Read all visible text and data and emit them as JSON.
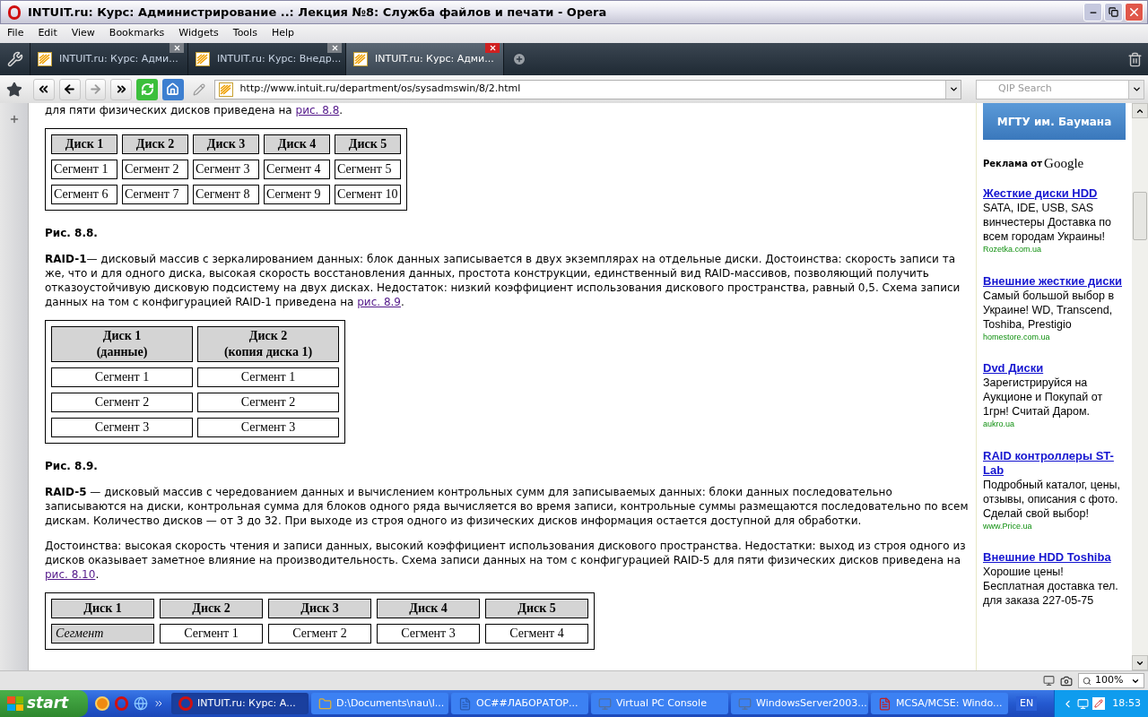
{
  "window": {
    "title": "INTUIT.ru: Курс: Администрирование ..: Лекция №8: Служба файлов и печати - Opera"
  },
  "menu": [
    "File",
    "Edit",
    "View",
    "Bookmarks",
    "Widgets",
    "Tools",
    "Help"
  ],
  "tabs": [
    {
      "label": "INTUIT.ru: Курс: Адми...",
      "selected": false
    },
    {
      "label": "INTUIT.ru: Курс: Внедр...",
      "selected": false
    },
    {
      "label": "INTUIT.ru: Курс: Адми...",
      "selected": true
    }
  ],
  "address_bar": {
    "url": "http://www.intuit.ru/department/os/sysadmswin/8/2.html"
  },
  "search": {
    "placeholder": "QIP Search"
  },
  "article": [
    {
      "kind": "paragraph",
      "text": "для пяти физических дисков приведена на",
      "link": "рис. 8.8",
      "after": "."
    },
    {
      "kind": "table",
      "header": [
        "Диск 1",
        "Диск 2",
        "Диск 3",
        "Диск 4",
        "Диск 5"
      ],
      "rows": [
        {
          "cells": [
            "Сегмент 1",
            "Сегмент 2",
            "Сегмент 3",
            "Сегмент 4",
            "Сегмент 5"
          ],
          "first_shaded": false
        },
        {
          "cells": [
            "Сегмент 6",
            "Сегмент 7",
            "Сегмент 8",
            "Сегмент 9",
            "Сегмент 10"
          ],
          "first_shaded": false
        }
      ]
    },
    {
      "kind": "caption",
      "text": "Рис. 8.8."
    },
    {
      "kind": "paragraph",
      "text": "**RAID-1**— дисковый массив с зеркалированием данных: блок данных записывается в двух экземплярах на отдельные диски. Достоинства: скорость записи та же, что и для одного диска, высокая скорость восстановления данных, простота конструкции, единственный вид RAID-массивов, позволяющий получить отказоустойчивую дисковую подсистему на двух дисках. Недостаток: низкий коэффициент использования дискового пространства, равный 0,5. Схема записи данных на том с конфигурацией RAID-1 приведена на",
      "link": "рис. 8.9",
      "after": "."
    },
    {
      "kind": "table",
      "header": [
        "Диск 1\n(данные)",
        "Диск 2\n(копия диска 1)"
      ],
      "rows": [
        {
          "cells": [
            "Сегмент 1",
            "Сегмент 1"
          ],
          "first_shaded": false
        },
        {
          "cells": [
            "Сегмент 2",
            "Сегмент 2"
          ],
          "first_shaded": false
        },
        {
          "cells": [
            "Сегмент 3",
            "Сегмент 3"
          ],
          "first_shaded": false
        }
      ]
    },
    {
      "kind": "caption",
      "text": "Рис. 8.9."
    },
    {
      "kind": "paragraph",
      "text": "**RAID-5** — дисковый массив с чередованием данных и вычислением контрольных сумм для записываемых данных: блоки данных последовательно записываются на диски, контрольная сумма для блоков одного ряда вычисляется во время записи, контрольные суммы размещаются последовательно по всем дискам. Количество дисков — от 3 до 32. При выходе из строя одного из физических дисков информация остается доступной для обработки."
    },
    {
      "kind": "paragraph",
      "text": "Достоинства: высокая скорость чтения и записи данных, высокий коэффициент использования дискового пространства. Недостатки: выход из строя одного из дисков оказывает заметное влияние на производительность. Схема записи данных на том с конфигурацией RAID-5 для пяти физических дисков приведена на",
      "link": "рис. 8.10",
      "after": "."
    },
    {
      "kind": "table",
      "header": [
        "Диск 1",
        "Диск 2",
        "Диск 3",
        "Диск 4",
        "Диск 5"
      ],
      "rows": [
        {
          "cells": [
            "Сегмент",
            "Сегмент 1",
            "Сегмент 2",
            "Сегмент 3",
            "Сегмент 4"
          ],
          "first_shaded": true
        }
      ]
    }
  ],
  "ads": {
    "banner": "МГТУ им. Баумана",
    "label": "Реклама от",
    "brand": "Google",
    "items": [
      {
        "title": "Жесткие диски HDD",
        "text": "SATA, IDE, USB, SAS винчестеры Доставка по всем городам Украины!",
        "url": "Rozetka.com.ua"
      },
      {
        "title": "Внешние жесткие диски",
        "text": "Самый большой выбор в Украине! WD, Transcend, Toshiba, Prestigio",
        "url": "homestore.com.ua"
      },
      {
        "title": "Dvd Диски",
        "text": "Зарегистрируйся на Аукционе и Покупай от 1грн! Считай Даром.",
        "url": "aukro.ua"
      },
      {
        "title": "RAID контроллеры ST-Lab",
        "text": "Подробный каталог, цены, отзывы, описания с фото. Сделай свой выбор!",
        "url": "www.Price.ua"
      },
      {
        "title": "Внешние HDD Toshiba",
        "text": "Хорошие цены! Бесплатная доставка тел. для заказа 227-05-75"
      }
    ]
  },
  "status_bar": {
    "zoom": "100%"
  },
  "taskbar": {
    "start": "start",
    "items": [
      {
        "label": "INTUIT.ru: Курс: А...",
        "selected": true,
        "kind": "browser"
      },
      {
        "label": "D:\\Documents\\nau\\l...",
        "selected": false,
        "kind": "folder"
      },
      {
        "label": "ОС##ЛАБОРАТОР...",
        "selected": false,
        "kind": "document"
      },
      {
        "label": "Virtual PC Console",
        "selected": false,
        "kind": "app"
      },
      {
        "label": "WindowsServer2003...",
        "selected": false,
        "kind": "app"
      },
      {
        "label": "MCSA/MCSE: Windo...",
        "selected": false,
        "kind": "pdf"
      }
    ],
    "language": "EN",
    "clock": "18:53"
  }
}
